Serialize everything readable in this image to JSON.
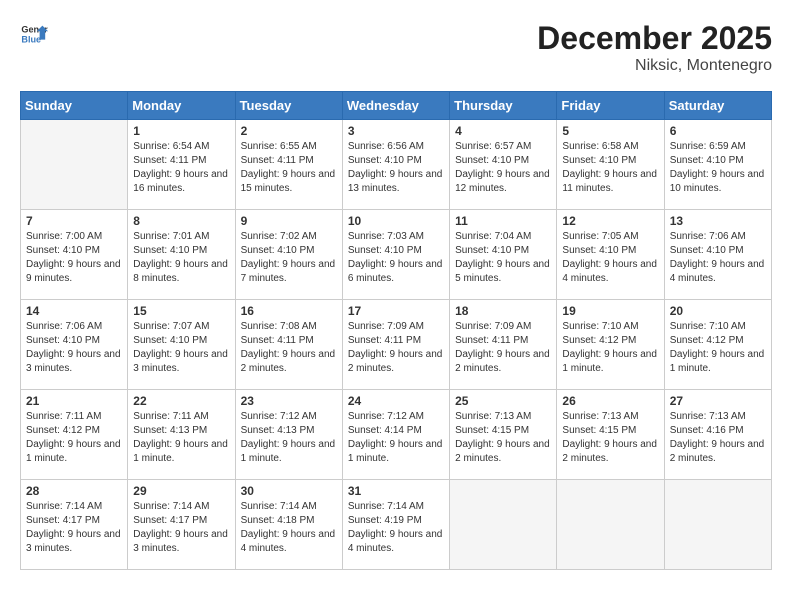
{
  "logo": {
    "text1": "General",
    "text2": "Blue"
  },
  "title": "December 2025",
  "location": "Niksic, Montenegro",
  "days_header": [
    "Sunday",
    "Monday",
    "Tuesday",
    "Wednesday",
    "Thursday",
    "Friday",
    "Saturday"
  ],
  "weeks": [
    [
      {
        "num": "",
        "empty": true
      },
      {
        "num": "1",
        "sunrise": "6:54 AM",
        "sunset": "4:11 PM",
        "daylight": "9 hours and 16 minutes."
      },
      {
        "num": "2",
        "sunrise": "6:55 AM",
        "sunset": "4:11 PM",
        "daylight": "9 hours and 15 minutes."
      },
      {
        "num": "3",
        "sunrise": "6:56 AM",
        "sunset": "4:10 PM",
        "daylight": "9 hours and 13 minutes."
      },
      {
        "num": "4",
        "sunrise": "6:57 AM",
        "sunset": "4:10 PM",
        "daylight": "9 hours and 12 minutes."
      },
      {
        "num": "5",
        "sunrise": "6:58 AM",
        "sunset": "4:10 PM",
        "daylight": "9 hours and 11 minutes."
      },
      {
        "num": "6",
        "sunrise": "6:59 AM",
        "sunset": "4:10 PM",
        "daylight": "9 hours and 10 minutes."
      }
    ],
    [
      {
        "num": "7",
        "sunrise": "7:00 AM",
        "sunset": "4:10 PM",
        "daylight": "9 hours and 9 minutes."
      },
      {
        "num": "8",
        "sunrise": "7:01 AM",
        "sunset": "4:10 PM",
        "daylight": "9 hours and 8 minutes."
      },
      {
        "num": "9",
        "sunrise": "7:02 AM",
        "sunset": "4:10 PM",
        "daylight": "9 hours and 7 minutes."
      },
      {
        "num": "10",
        "sunrise": "7:03 AM",
        "sunset": "4:10 PM",
        "daylight": "9 hours and 6 minutes."
      },
      {
        "num": "11",
        "sunrise": "7:04 AM",
        "sunset": "4:10 PM",
        "daylight": "9 hours and 5 minutes."
      },
      {
        "num": "12",
        "sunrise": "7:05 AM",
        "sunset": "4:10 PM",
        "daylight": "9 hours and 4 minutes."
      },
      {
        "num": "13",
        "sunrise": "7:06 AM",
        "sunset": "4:10 PM",
        "daylight": "9 hours and 4 minutes."
      }
    ],
    [
      {
        "num": "14",
        "sunrise": "7:06 AM",
        "sunset": "4:10 PM",
        "daylight": "9 hours and 3 minutes."
      },
      {
        "num": "15",
        "sunrise": "7:07 AM",
        "sunset": "4:10 PM",
        "daylight": "9 hours and 3 minutes."
      },
      {
        "num": "16",
        "sunrise": "7:08 AM",
        "sunset": "4:11 PM",
        "daylight": "9 hours and 2 minutes."
      },
      {
        "num": "17",
        "sunrise": "7:09 AM",
        "sunset": "4:11 PM",
        "daylight": "9 hours and 2 minutes."
      },
      {
        "num": "18",
        "sunrise": "7:09 AM",
        "sunset": "4:11 PM",
        "daylight": "9 hours and 2 minutes."
      },
      {
        "num": "19",
        "sunrise": "7:10 AM",
        "sunset": "4:12 PM",
        "daylight": "9 hours and 1 minute."
      },
      {
        "num": "20",
        "sunrise": "7:10 AM",
        "sunset": "4:12 PM",
        "daylight": "9 hours and 1 minute."
      }
    ],
    [
      {
        "num": "21",
        "sunrise": "7:11 AM",
        "sunset": "4:12 PM",
        "daylight": "9 hours and 1 minute."
      },
      {
        "num": "22",
        "sunrise": "7:11 AM",
        "sunset": "4:13 PM",
        "daylight": "9 hours and 1 minute."
      },
      {
        "num": "23",
        "sunrise": "7:12 AM",
        "sunset": "4:13 PM",
        "daylight": "9 hours and 1 minute."
      },
      {
        "num": "24",
        "sunrise": "7:12 AM",
        "sunset": "4:14 PM",
        "daylight": "9 hours and 1 minute."
      },
      {
        "num": "25",
        "sunrise": "7:13 AM",
        "sunset": "4:15 PM",
        "daylight": "9 hours and 2 minutes."
      },
      {
        "num": "26",
        "sunrise": "7:13 AM",
        "sunset": "4:15 PM",
        "daylight": "9 hours and 2 minutes."
      },
      {
        "num": "27",
        "sunrise": "7:13 AM",
        "sunset": "4:16 PM",
        "daylight": "9 hours and 2 minutes."
      }
    ],
    [
      {
        "num": "28",
        "sunrise": "7:14 AM",
        "sunset": "4:17 PM",
        "daylight": "9 hours and 3 minutes."
      },
      {
        "num": "29",
        "sunrise": "7:14 AM",
        "sunset": "4:17 PM",
        "daylight": "9 hours and 3 minutes."
      },
      {
        "num": "30",
        "sunrise": "7:14 AM",
        "sunset": "4:18 PM",
        "daylight": "9 hours and 4 minutes."
      },
      {
        "num": "31",
        "sunrise": "7:14 AM",
        "sunset": "4:19 PM",
        "daylight": "9 hours and 4 minutes."
      },
      {
        "num": "",
        "empty": true
      },
      {
        "num": "",
        "empty": true
      },
      {
        "num": "",
        "empty": true
      }
    ]
  ],
  "labels": {
    "sunrise": "Sunrise:",
    "sunset": "Sunset:",
    "daylight": "Daylight:"
  }
}
